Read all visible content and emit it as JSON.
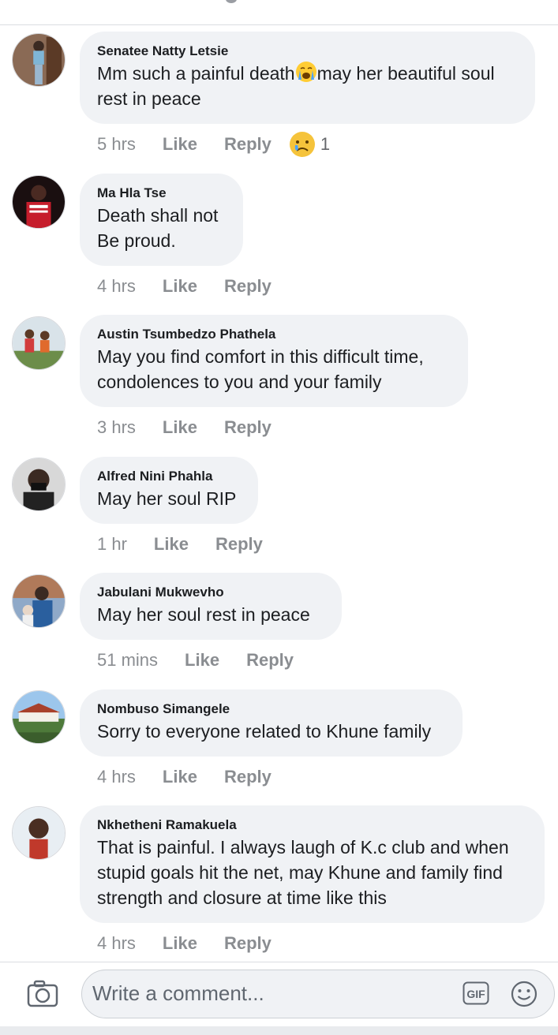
{
  "comments": [
    {
      "author": "Senatee Natty Letsie",
      "text": "Mm such a painful death",
      "text_after_emoji": "may her beautiful soul rest in peace",
      "time": "5 hrs",
      "like": "Like",
      "reply": "Reply",
      "reaction_count": "1"
    },
    {
      "author": "Ma Hla Tse",
      "text": "Death shall not\nBe proud.",
      "time": "4 hrs",
      "like": "Like",
      "reply": "Reply"
    },
    {
      "author": "Austin Tsumbedzo Phathela",
      "text": "May you find comfort in this difficult time,\ncondolences to you and your family",
      "time": "3 hrs",
      "like": "Like",
      "reply": "Reply"
    },
    {
      "author": "Alfred Nini Phahla",
      "text": "May her soul RIP",
      "time": "1 hr",
      "like": "Like",
      "reply": "Reply"
    },
    {
      "author": "Jabulani Mukwevho",
      "text": "May her soul rest in peace",
      "time": "51 mins",
      "like": "Like",
      "reply": "Reply"
    },
    {
      "author": "Nombuso Simangele",
      "text": "Sorry to everyone related to Khune family",
      "time": "4 hrs",
      "like": "Like",
      "reply": "Reply"
    },
    {
      "author": "Nkhetheni Ramakuela",
      "text": "That is painful. I always laugh of K.c club and when\nstupid goals hit the net, may Khune and family find\nstrength and closure at time like this",
      "time": "4 hrs",
      "like": "Like",
      "reply": "Reply"
    }
  ],
  "composer": {
    "placeholder": "Write a comment..."
  },
  "icons": {
    "camera": "camera-icon",
    "gif": "gif-icon",
    "emoji": "emoji-icon",
    "crying": "crying-emoji",
    "sad_reaction": "sad-reaction-icon"
  }
}
